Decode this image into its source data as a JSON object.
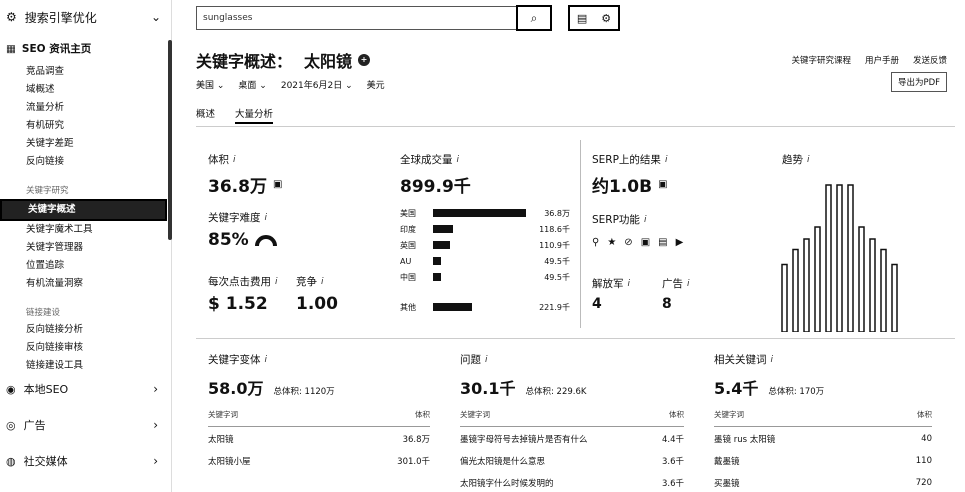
{
  "sidebar": {
    "top_label": "搜索引擎优化",
    "section_label": "SEO 资讯主页",
    "group1": [
      "竞品调查",
      "域概述",
      "流量分析",
      "有机研究",
      "关键字差距",
      "反向链接"
    ],
    "group2_title": "关键字研究",
    "group2": [
      "关键字概述",
      "关键字魔术工具",
      "关键字管理器",
      "位置追踪",
      "有机流量洞察"
    ],
    "group3_title": "链接建设",
    "group3": [
      "反向链接分析",
      "反向链接审核",
      "链接建设工具"
    ],
    "bottom": [
      "本地SEO",
      "广告",
      "社交媒体"
    ]
  },
  "search": {
    "value": "sunglasses",
    "button_icon": "search-icon"
  },
  "header": {
    "title_prefix": "关键字概述：",
    "title_keyword": "太阳镜",
    "filters": [
      "美国",
      "桌面",
      "2021年6月2日",
      "美元"
    ],
    "tabs": [
      "概述",
      "大量分析"
    ],
    "top_links": [
      "关键字研究课程",
      "用户手册",
      "发送反馈"
    ],
    "pdf_button": "导出为PDF"
  },
  "metrics": {
    "volume_label": "体积",
    "volume_value": "36.8万",
    "kd_label": "关键字难度",
    "kd_value": "85%",
    "cpc_label": "每次点击费用",
    "cpc_value": "$ 1.52",
    "comp_label": "竞争",
    "comp_value": "1.00",
    "global_label": "全球成交量",
    "global_value": "899.9千",
    "countries": [
      {
        "name": "美国",
        "value": "36.8万",
        "bar": 0.95
      },
      {
        "name": "印度",
        "value": "118.6千",
        "bar": 0.2
      },
      {
        "name": "英国",
        "value": "110.9千",
        "bar": 0.17
      },
      {
        "name": "AU",
        "value": "49.5千",
        "bar": 0.08
      },
      {
        "name": "中国",
        "value": "49.5千",
        "bar": 0.08
      },
      {
        "name": "其他",
        "value": "221.9千",
        "bar": 0.4
      }
    ],
    "serp_label": "SERP上的结果",
    "serp_value": "约1.0B",
    "serp_feat_label": "SERP功能",
    "kill_label": "解放军",
    "kill_value": "4",
    "ads_label": "广告",
    "ads_value": "8",
    "trend_label": "趋势"
  },
  "kw_sections": [
    {
      "title": "关键字变体",
      "value": "58.0万",
      "total": "总体积: 1120万",
      "col1": "关键字词",
      "col2": "体积",
      "rows": [
        [
          "太阳镜",
          "36.8万"
        ],
        [
          "太阳镜小屋",
          "301.0千"
        ]
      ]
    },
    {
      "title": "问题",
      "value": "30.1千",
      "total": "总体积: 229.6K",
      "col1": "关键字词",
      "col2": "体积",
      "rows": [
        [
          "墨镜字母符号去掉镜片是否有什么",
          "4.4千"
        ],
        [
          "偏光太阳镜是什么意思",
          "3.6千"
        ],
        [
          "太阳镜字什么时候发明的",
          "3.6千"
        ]
      ]
    },
    {
      "title": "相关关键词",
      "value": "5.4千",
      "total": "总体积: 170万",
      "col1": "关键字词",
      "col2": "体积",
      "rows": [
        [
          "墨镜 rus 太阳镜",
          "40"
        ],
        [
          "戴墨镜",
          "110"
        ],
        [
          "买墨镜",
          "720"
        ]
      ]
    }
  ],
  "trend_data": [
    0.45,
    0.55,
    0.62,
    0.7,
    0.98,
    0.98,
    0.98,
    0.7,
    0.62,
    0.55,
    0.45
  ]
}
